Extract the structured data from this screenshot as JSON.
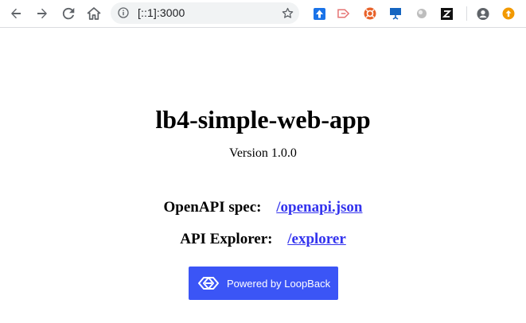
{
  "browser": {
    "url": "[::1]:3000"
  },
  "page": {
    "title": "lb4-simple-web-app",
    "version": "Version 1.0.0",
    "openapi_label": "OpenAPI spec:",
    "openapi_link": "/openapi.json",
    "explorer_label": "API Explorer:",
    "explorer_link": "/explorer",
    "badge_text": "Powered by LoopBack"
  },
  "colors": {
    "link": "#3333ee",
    "badge": "#3b55f6"
  },
  "icons": [
    "back-icon",
    "forward-icon",
    "reload-icon",
    "home-icon",
    "info-icon",
    "bookmark-star-icon",
    "profile-icon",
    "update-icon",
    "loopback-logo-icon"
  ]
}
